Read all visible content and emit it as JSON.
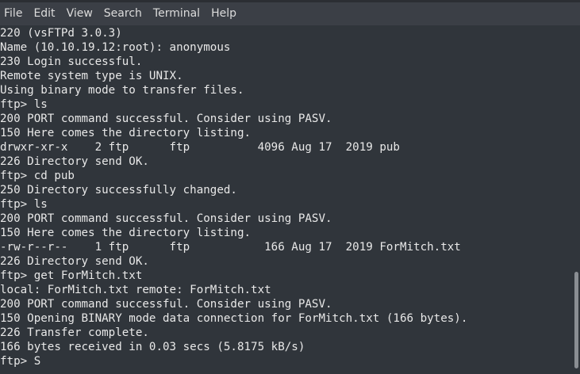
{
  "menu": {
    "items": [
      {
        "label": "File"
      },
      {
        "label": "Edit"
      },
      {
        "label": "View"
      },
      {
        "label": "Search"
      },
      {
        "label": "Terminal"
      },
      {
        "label": "Help"
      }
    ]
  },
  "terminal": {
    "lines": [
      "220 (vsFTPd 3.0.3)",
      "Name (10.10.19.12:root): anonymous",
      "230 Login successful.",
      "Remote system type is UNIX.",
      "Using binary mode to transfer files.",
      "ftp> ls",
      "200 PORT command successful. Consider using PASV.",
      "150 Here comes the directory listing.",
      "drwxr-xr-x    2 ftp      ftp          4096 Aug 17  2019 pub",
      "226 Directory send OK.",
      "ftp> cd pub",
      "250 Directory successfully changed.",
      "ftp> ls",
      "200 PORT command successful. Consider using PASV.",
      "150 Here comes the directory listing.",
      "-rw-r--r--    1 ftp      ftp           166 Aug 17  2019 ForMitch.txt",
      "226 Directory send OK.",
      "ftp> get ForMitch.txt",
      "local: ForMitch.txt remote: ForMitch.txt",
      "200 PORT command successful. Consider using PASV.",
      "150 Opening BINARY mode data connection for ForMitch.txt (166 bytes).",
      "226 Transfer complete.",
      "166 bytes received in 0.03 secs (5.8175 kB/s)",
      "ftp> S"
    ]
  }
}
